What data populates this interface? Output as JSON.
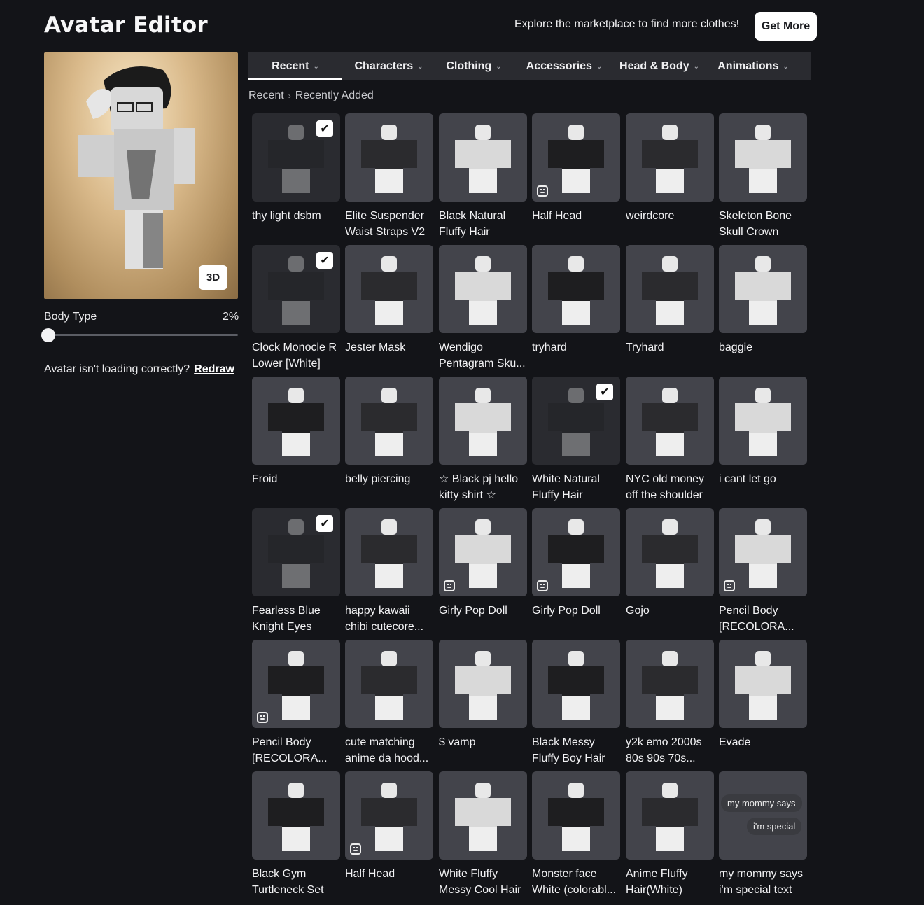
{
  "header": {
    "title": "Avatar Editor",
    "promo_text": "Explore the marketplace to find more clothes!",
    "get_more_label": "Get More"
  },
  "avatar": {
    "view_toggle_label": "3D",
    "body_type_label": "Body Type",
    "body_type_value": "2%",
    "body_type_fraction": 0.02,
    "loading_message": "Avatar isn't loading correctly?",
    "redraw_label": "Redraw"
  },
  "tabs": [
    {
      "label": "Recent",
      "active": true
    },
    {
      "label": "Characters",
      "active": false
    },
    {
      "label": "Clothing",
      "active": false
    },
    {
      "label": "Accessories",
      "active": false
    },
    {
      "label": "Head & Body",
      "active": false
    },
    {
      "label": "Animations",
      "active": false
    }
  ],
  "breadcrumb": [
    "Recent",
    "Recently Added"
  ],
  "items": [
    {
      "name": "thy light dsbm",
      "checked": true,
      "badge": false
    },
    {
      "name": "Elite Suspender Waist Straps V2",
      "checked": false,
      "badge": false
    },
    {
      "name": "Black Natural Fluffy Hair",
      "checked": false,
      "badge": false
    },
    {
      "name": "Half Head",
      "checked": false,
      "badge": true
    },
    {
      "name": "weirdcore",
      "checked": false,
      "badge": false
    },
    {
      "name": "Skeleton Bone Skull Crown",
      "checked": false,
      "badge": false
    },
    {
      "name": "Clock Monocle R Lower [White]",
      "checked": true,
      "badge": false
    },
    {
      "name": "Jester Mask",
      "checked": false,
      "badge": false
    },
    {
      "name": "Wendigo Pentagram Sku...",
      "checked": false,
      "badge": false
    },
    {
      "name": "tryhard",
      "checked": false,
      "badge": false
    },
    {
      "name": "Tryhard",
      "checked": false,
      "badge": false
    },
    {
      "name": "baggie",
      "checked": false,
      "badge": false
    },
    {
      "name": "Froid",
      "checked": false,
      "badge": false
    },
    {
      "name": "belly piercing",
      "checked": false,
      "badge": false
    },
    {
      "name": "☆ Black pj hello kitty shirt ☆",
      "checked": false,
      "badge": false
    },
    {
      "name": "White Natural Fluffy Hair",
      "checked": true,
      "badge": false
    },
    {
      "name": "NYC old money off the shoulder",
      "checked": false,
      "badge": false
    },
    {
      "name": "i cant let go",
      "checked": false,
      "badge": false
    },
    {
      "name": "Fearless Blue Knight Eyes",
      "checked": true,
      "badge": false
    },
    {
      "name": "happy kawaii chibi cutecore...",
      "checked": false,
      "badge": false
    },
    {
      "name": "Girly Pop Doll",
      "checked": false,
      "badge": true
    },
    {
      "name": "Girly Pop Doll",
      "checked": false,
      "badge": true
    },
    {
      "name": "Gojo",
      "checked": false,
      "badge": false
    },
    {
      "name": "Pencil Body [RECOLORA...",
      "checked": false,
      "badge": true
    },
    {
      "name": "Pencil Body [RECOLORA...",
      "checked": false,
      "badge": true
    },
    {
      "name": "cute matching anime da hood...",
      "checked": false,
      "badge": false
    },
    {
      "name": "$ vamp",
      "checked": false,
      "badge": false
    },
    {
      "name": "Black Messy Fluffy Boy Hair",
      "checked": false,
      "badge": false
    },
    {
      "name": "y2k emo 2000s 80s 90s 70s...",
      "checked": false,
      "badge": false
    },
    {
      "name": "Evade",
      "checked": false,
      "badge": false
    },
    {
      "name": "Black Gym Turtleneck Set",
      "checked": false,
      "badge": false
    },
    {
      "name": "Half Head",
      "checked": false,
      "badge": true
    },
    {
      "name": "White Fluffy Messy Cool Hair",
      "checked": false,
      "badge": false
    },
    {
      "name": "Monster face White (colorabl...",
      "checked": false,
      "badge": false
    },
    {
      "name": "Anime Fluffy Hair(White)",
      "checked": false,
      "badge": false
    },
    {
      "name": "my mommy says i'm special text",
      "checked": false,
      "badge": false
    }
  ],
  "bubble_item": {
    "line1": "my mommy says",
    "line2": "i'm special"
  },
  "icons": {
    "check": "check-icon",
    "chevron": "chevron-down-icon",
    "animated_badge": "face-badge-icon"
  }
}
